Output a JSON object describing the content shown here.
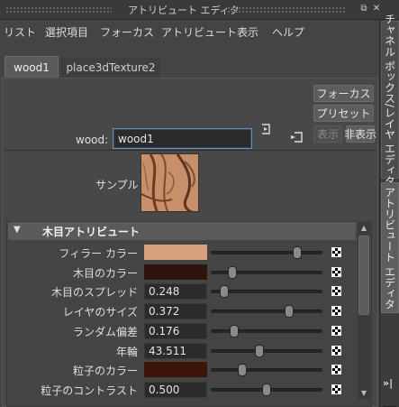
{
  "window": {
    "title": "アトリビュート エディタ"
  },
  "menu": [
    "リスト",
    "選択項目",
    "フォーカス",
    "アトリビュート",
    "表示",
    "ヘルプ"
  ],
  "node_tabs": [
    "wood1",
    "place3dTexture2"
  ],
  "node": {
    "label": "wood:",
    "value": "wood1"
  },
  "buttons": {
    "focus": "フォーカス",
    "preset": "プリセット",
    "show": "表示",
    "hide": "非表示"
  },
  "sample": {
    "label": "サンプル"
  },
  "section": {
    "title": "木目アトリビュート"
  },
  "attributes": [
    {
      "label": "フィラー カラー",
      "type": "color",
      "color": "#d8a27c",
      "slider": 0.8
    },
    {
      "label": "木目のカラー",
      "type": "color",
      "color": "#2d140c",
      "slider": 0.17
    },
    {
      "label": "木目のスプレッド",
      "type": "number",
      "value": "0.248",
      "slider": 0.09
    },
    {
      "label": "レイヤのサイズ",
      "type": "number",
      "value": "0.372",
      "slider": 0.72
    },
    {
      "label": "ランダム偏差",
      "type": "number",
      "value": "0.176",
      "slider": 0.18
    },
    {
      "label": "年輪",
      "type": "number",
      "value": "43.511",
      "slider": 0.43
    },
    {
      "label": "粒子のカラー",
      "type": "color",
      "color": "#3b1509",
      "slider": 0.26
    },
    {
      "label": "粒子のコントラスト",
      "type": "number",
      "value": "0.500",
      "slider": 0.5
    }
  ],
  "side_tabs": {
    "channel_box": "チャネル ボックス/レイヤ エディタ",
    "attribute_editor": "アトリビュート エディタ",
    "expand": "»|"
  },
  "colors": {
    "panel_bg": "#444444",
    "field_focus": "#6a8fb3",
    "filler_color": "#d8a27c",
    "vein_color": "#2d140c",
    "grain_color": "#3b1509"
  }
}
